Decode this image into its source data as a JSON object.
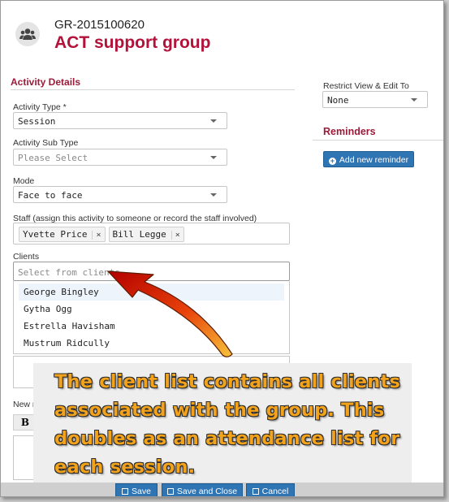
{
  "header": {
    "group_id": "GR-2015100620",
    "group_name": "ACT support group",
    "avatar_icon": "users-icon"
  },
  "activity_details": {
    "title": "Activity Details",
    "activity_type": {
      "label": "Activity Type *",
      "value": "Session"
    },
    "activity_sub_type": {
      "label": "Activity Sub Type",
      "placeholder": "Please Select"
    },
    "mode": {
      "label": "Mode",
      "value": "Face to face"
    },
    "staff": {
      "label": "Staff (assign this activity to someone or record the staff involved)",
      "tags": [
        "Yvette Price",
        "Bill Legge"
      ],
      "remove_glyph": "×"
    },
    "clients": {
      "label": "Clients",
      "placeholder": "Select from clients",
      "options": [
        "George Bingley",
        "Gytha Ogg",
        "Estrella Havisham",
        "Mustrum Ridcully"
      ]
    },
    "new_note_label": "New no",
    "bold_button": "B"
  },
  "sidebar": {
    "restrict_label": "Restrict View & Edit To",
    "restrict_value": "None",
    "reminders_title": "Reminders",
    "add_reminder": "Add new reminder"
  },
  "callout": {
    "text": "The client list contains all clients associated with the group. This doubles as an attendance list for each session."
  },
  "footer": {
    "save": "Save",
    "save_close": "Save and Close",
    "cancel": "Cancel"
  },
  "colors": {
    "accent": "#b3123a",
    "button": "#2f74b3",
    "callout_text": "#f3a21c"
  }
}
